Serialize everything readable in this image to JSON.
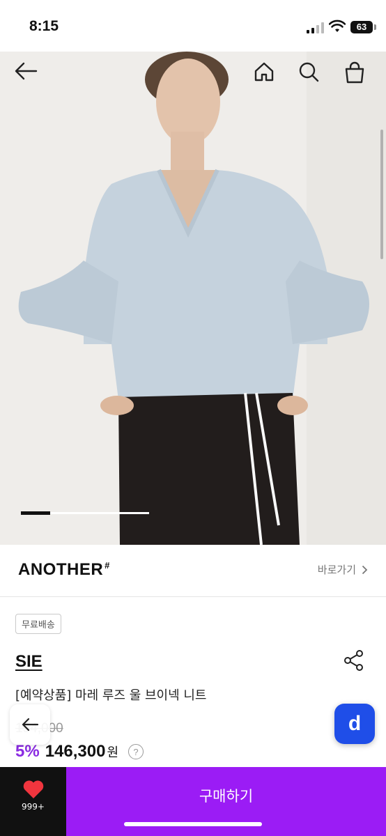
{
  "status_bar": {
    "time": "8:15",
    "battery": "63"
  },
  "header": {
    "back_icon": "arrow-left-icon",
    "home_icon": "home-icon",
    "search_icon": "search-icon",
    "cart_icon": "shopping-bag-icon"
  },
  "brand": {
    "name": "ANOTHER",
    "mark": "#",
    "shortcut_label": "바로가기"
  },
  "product": {
    "badge": "무료배송",
    "seller": "SIE",
    "title": "[예약상품] 마레 루즈 울 브이넥 니트",
    "original_price": "154,000",
    "discount": "5%",
    "price": "146,300",
    "price_unit": "원"
  },
  "floating": {
    "d_label": "d"
  },
  "bottom_bar": {
    "like_count": "999+",
    "buy_label": "구매하기"
  },
  "colors": {
    "accent_purple": "#9b1cf5",
    "discount_purple": "#8a2be2",
    "d_blue": "#1f4ee8"
  }
}
